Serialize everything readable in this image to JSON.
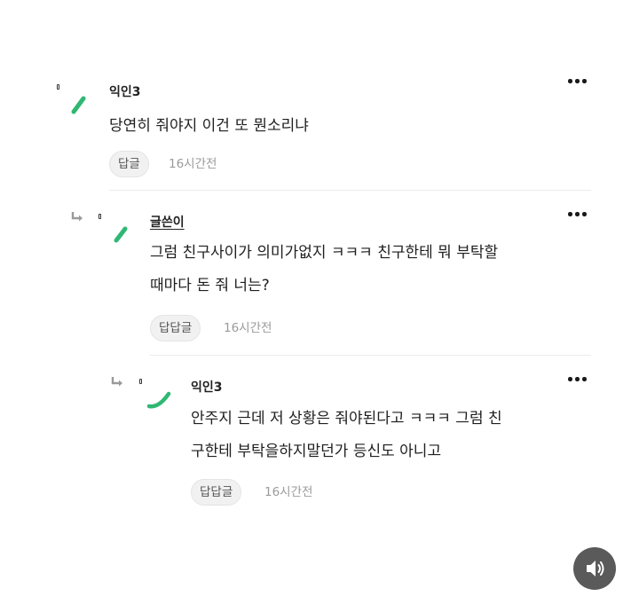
{
  "colors": {
    "avatar_accent": "#2fb873",
    "button_bg": "#f1f1f1",
    "time_text": "#9a9a9a"
  },
  "comments": [
    {
      "author": "익인3",
      "lines": [
        "당연히 줘야지 이건 또 뭔소리냐"
      ],
      "reply_label": "답글",
      "time": "16시간전"
    },
    {
      "author": "글쓴이",
      "lines": [
        "그럼 친구사이가 의미가없지 ㅋㅋㅋ 친구한테 뭐 부탁할",
        "때마다 돈 줘 너는?"
      ],
      "reply_label": "답답글",
      "time": "16시간전"
    },
    {
      "author": "익인3",
      "lines": [
        "안주지 근데 저 상황은 줘야된다고 ㅋㅋㅋ 그럼 친",
        "구한테 부탁을하지말던가 등신도 아니고"
      ],
      "reply_label": "답답글",
      "time": "16시간전"
    }
  ],
  "icons": {
    "more": "more-dots-icon",
    "reply": "reply-arrow-icon",
    "sound": "speaker-icon"
  }
}
